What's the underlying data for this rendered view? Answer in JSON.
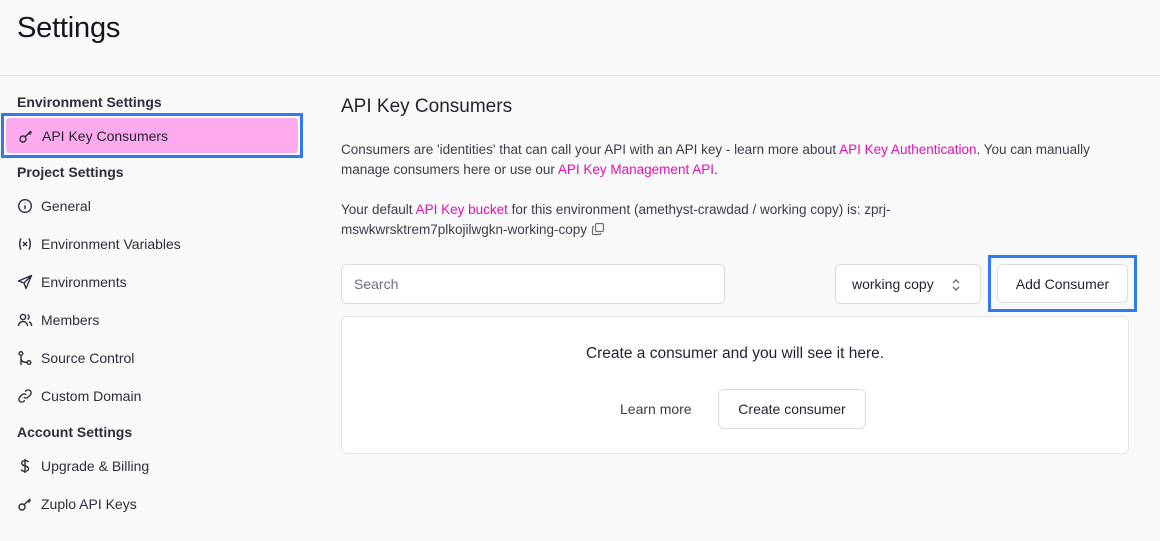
{
  "page": {
    "title": "Settings"
  },
  "sidebar": {
    "environment_label": "Environment Settings",
    "project_label": "Project Settings",
    "account_label": "Account Settings",
    "environment_items": [
      {
        "label": "API Key Consumers",
        "icon": "key-icon",
        "active": true
      }
    ],
    "project_items": [
      {
        "label": "General",
        "icon": "info-icon"
      },
      {
        "label": "Environment Variables",
        "icon": "variable-icon"
      },
      {
        "label": "Environments",
        "icon": "send-icon"
      },
      {
        "label": "Members",
        "icon": "users-icon"
      },
      {
        "label": "Source Control",
        "icon": "git-icon"
      },
      {
        "label": "Custom Domain",
        "icon": "link-icon"
      }
    ],
    "account_items": [
      {
        "label": "Upgrade & Billing",
        "icon": "dollar-icon"
      },
      {
        "label": "Zuplo API Keys",
        "icon": "key-icon"
      }
    ]
  },
  "main": {
    "title": "API Key Consumers",
    "intro_1": "Consumers are 'identities' that can call your API with an API key - learn more about ",
    "intro_link_1": "API Key Authentication",
    "intro_2": ". You can manually manage consumers here or use our ",
    "intro_link_2": "API Key Management API",
    "intro_3": ".",
    "bucket_1": "Your default ",
    "bucket_link": "API Key bucket",
    "bucket_2": " for this environment (amethyst-crawdad / working copy) is: zprj-mswkwrsktrem7plkojilwgkn-working-copy",
    "search_placeholder": "Search",
    "search_value": "",
    "env_select": "working copy",
    "add_button": "Add Consumer",
    "empty_text": "Create a consumer and you will see it here.",
    "learn_more": "Learn more",
    "create_button": "Create consumer"
  },
  "colors": {
    "accent_link": "#e60fb4",
    "active_bg": "#ffaaee",
    "highlight_border": "#2f7af0"
  }
}
